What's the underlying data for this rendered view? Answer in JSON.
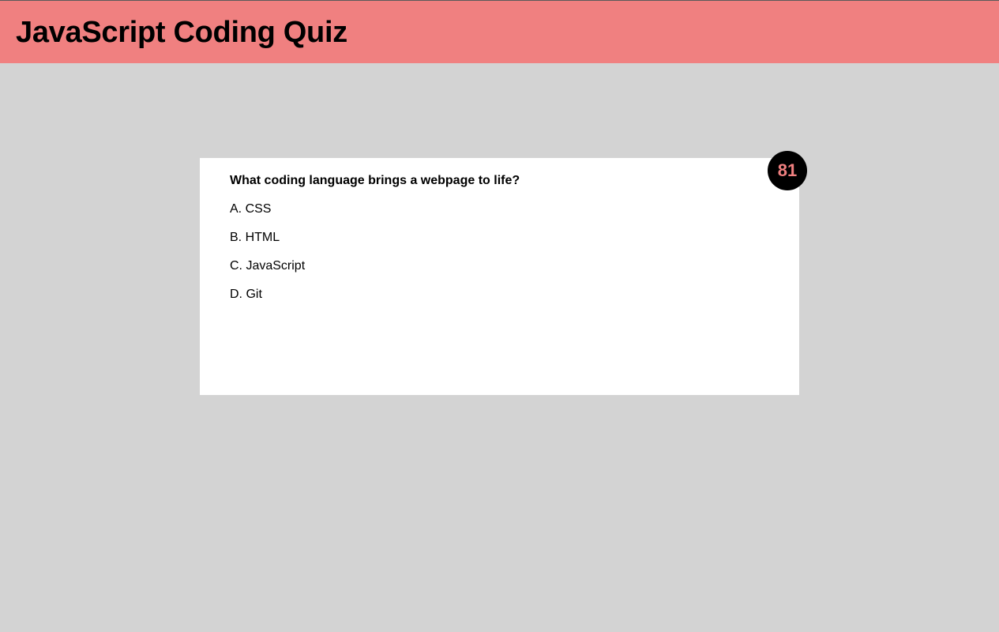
{
  "header": {
    "title": "JavaScript Coding Quiz"
  },
  "quiz": {
    "question": "What coding language brings a webpage to life?",
    "answers": [
      "A. CSS",
      "B. HTML",
      "C. JavaScript",
      "D. Git"
    ]
  },
  "timer": {
    "seconds_remaining": "81"
  },
  "colors": {
    "header_bg": "#f08080",
    "page_bg": "#d3d3d3",
    "card_bg": "#ffffff",
    "timer_bg": "#000000",
    "timer_text": "#f08080"
  }
}
